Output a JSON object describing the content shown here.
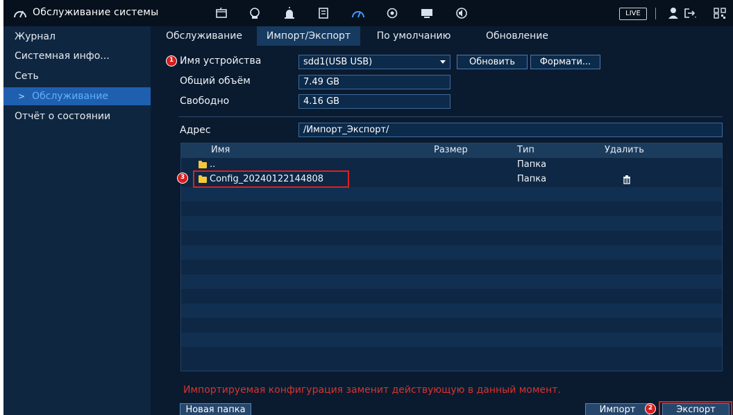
{
  "header": {
    "title": "Обслуживание системы",
    "live_label": "LIVE",
    "icons": [
      "speedometer-icon",
      "film-icon",
      "face-icon",
      "alarm-icon",
      "storage-icon",
      "gauge-icon",
      "camera-ring-icon",
      "monitor-icon",
      "speaker-icon",
      "user-icon",
      "logout-icon",
      "qr-code-icon"
    ]
  },
  "sidebar": {
    "items": [
      {
        "label": "Журнал"
      },
      {
        "label": "Системная инфо..."
      },
      {
        "label": "Сеть"
      },
      {
        "label": "Обслуживание",
        "active": true
      },
      {
        "label": "Отчёт о состоянии"
      }
    ]
  },
  "tabs": [
    {
      "label": "Обслуживание"
    },
    {
      "label": "Импорт/Экспорт",
      "active": true
    },
    {
      "label": "По умолчанию"
    },
    {
      "label": "Обновление"
    }
  ],
  "form": {
    "device_name_label": "Имя устройства",
    "device_value": "sdd1(USB USB)",
    "refresh_label": "Обновить",
    "format_label": "Формати...",
    "total_label": "Общий объём",
    "total_value": "7.49 GB",
    "free_label": "Свободно",
    "free_value": "4.16 GB",
    "address_label": "Адрес",
    "address_value": "/Импорт_Экспорт/"
  },
  "table": {
    "headers": {
      "name": "Имя",
      "size": "Размер",
      "type": "Тип",
      "delete": "Удалить"
    },
    "rows": [
      {
        "name": "..",
        "size": "",
        "type": "Папка"
      },
      {
        "name": "Config_20240122144808",
        "size": "",
        "type": "Папка"
      }
    ]
  },
  "annotations": [
    "1",
    "2",
    "3"
  ],
  "warning": "Импортируемая конфигурация заменит действующую в данный момент.",
  "footer": {
    "new_folder_label": "Новая папка",
    "import_label": "Импорт",
    "export_label": "Экспорт"
  },
  "colors": {
    "background": "#0a1b30",
    "active_menu": "#1f5faf",
    "warning_text": "#d8332f",
    "callout_red": "#e02020"
  }
}
